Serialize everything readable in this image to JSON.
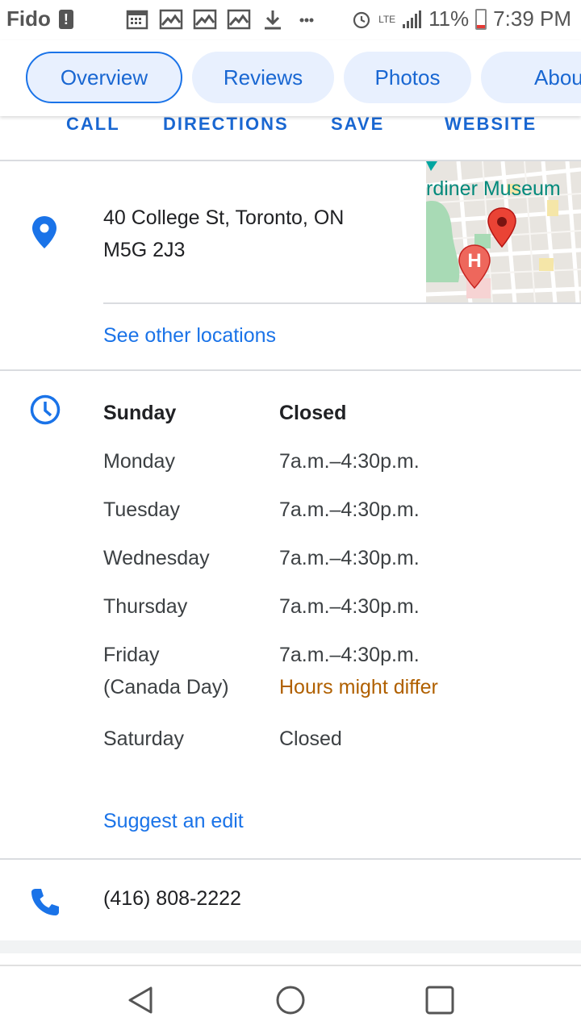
{
  "status_bar": {
    "carrier": "Fido",
    "network": "LTE",
    "battery": "11%",
    "time": "7:39 PM",
    "icons": [
      "alert-icon",
      "calendar-icon",
      "image-icon",
      "image-icon",
      "image-icon",
      "download-icon",
      "more-icon",
      "alarm-icon",
      "lte-icon",
      "signal-icon",
      "battery-icon"
    ]
  },
  "tabs": [
    {
      "label": "Overview",
      "active": true
    },
    {
      "label": "Reviews",
      "active": false
    },
    {
      "label": "Photos",
      "active": false
    },
    {
      "label": "About",
      "active": false
    }
  ],
  "actions": {
    "call": "CALL",
    "directions": "DIRECTIONS",
    "save": "SAVE",
    "website": "WEBSITE"
  },
  "address": {
    "line1": "40 College St, Toronto, ON",
    "line2": "M5G 2J3",
    "map_label": "rdiner Museum",
    "hospital_marker": "H",
    "see_other": "See other locations"
  },
  "hours": {
    "rows": [
      {
        "day": "Sunday",
        "hours": "Closed"
      },
      {
        "day": "Monday",
        "hours": "7a.m.–4:30p.m."
      },
      {
        "day": "Tuesday",
        "hours": "7a.m.–4:30p.m."
      },
      {
        "day": "Wednesday",
        "hours": "7a.m.–4:30p.m."
      },
      {
        "day": "Thursday",
        "hours": "7a.m.–4:30p.m."
      },
      {
        "day": "Friday",
        "hours": "7a.m.–4:30p.m."
      },
      {
        "day": "Saturday",
        "hours": "Closed"
      }
    ],
    "friday_note": "(Canada Day)",
    "friday_warning": "Hours might differ",
    "suggest_edit": "Suggest an edit"
  },
  "phone": "(416) 808-2222",
  "colors": {
    "accent": "#1a73e8",
    "warning": "#b06000",
    "tab_bg": "#e8f0fe"
  }
}
